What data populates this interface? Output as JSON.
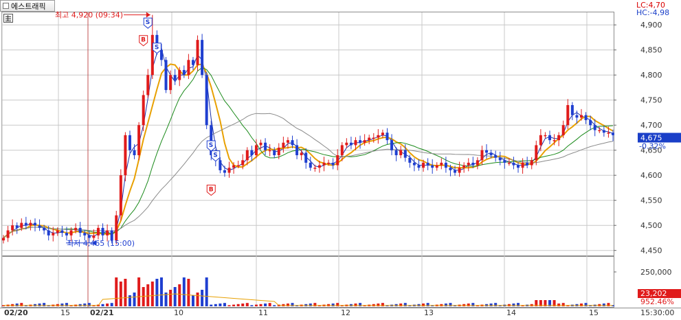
{
  "header": {
    "stock_tab_label": "에스트래픽",
    "lc_text": "LC:4,70",
    "hc_text": "HC:-4,98"
  },
  "annotations": {
    "high_text": "최고 4,920 (09:34)",
    "low_text": "최저 4,465 (15:00)",
    "current_price": "4,675",
    "change_pct": "-0.32%",
    "volume_current": "23,202",
    "volume_pct": "952.46%",
    "buy_marker": "B",
    "sell_marker": "S"
  },
  "price_axis": {
    "ticks": [
      "4,900",
      "4,850",
      "4,800",
      "4,750",
      "4,700",
      "4,650",
      "4,600",
      "4,550",
      "4,500",
      "4,450"
    ]
  },
  "volume_axis": {
    "ticks": [
      "250,000"
    ]
  },
  "time_axis": {
    "labels": [
      "02/20",
      "15",
      "02/21",
      "10",
      "11",
      "12",
      "13",
      "14",
      "15"
    ],
    "right_label": "15:30:00"
  },
  "colors": {
    "up": "#e01b1b",
    "down": "#1f3fd0",
    "ma_orange": "#e8a000",
    "ma_green": "#1a8a1a",
    "ma_gray": "#8a8a8a",
    "ma_blue": "#1a2fa8",
    "grid": "#c8c8c8",
    "marker_line": "#c05050"
  },
  "chart_data": {
    "type": "candlestick",
    "price_ylim": [
      4440,
      4925
    ],
    "high": {
      "value": 4920,
      "time": "09:34"
    },
    "low": {
      "value": 4465,
      "time": "15:00"
    },
    "current": 4675,
    "change_pct": -0.32,
    "volume_ylim": [
      0,
      350000
    ],
    "close_series": [
      4475,
      4490,
      4500,
      4495,
      4505,
      4500,
      4505,
      4500,
      4495,
      4490,
      4480,
      4485,
      4490,
      4485,
      4480,
      4490,
      4495,
      4485,
      4480,
      4475,
      4480,
      4495,
      4480,
      4490,
      4470,
      4520,
      4600,
      4680,
      4650,
      4640,
      4700,
      4760,
      4800,
      4880,
      4850,
      4830,
      4770,
      4800,
      4790,
      4810,
      4800,
      4830,
      4820,
      4870,
      4800,
      4700,
      4640,
      4630,
      4610,
      4605,
      4615,
      4620,
      4620,
      4630,
      4650,
      4640,
      4660,
      4665,
      4650,
      4650,
      4640,
      4655,
      4665,
      4670,
      4660,
      4640,
      4645,
      4625,
      4615,
      4615,
      4620,
      4625,
      4625,
      4620,
      4640,
      4660,
      4665,
      4660,
      4670,
      4665,
      4670,
      4675,
      4675,
      4680,
      4685,
      4670,
      4650,
      4640,
      4650,
      4635,
      4625,
      4620,
      4615,
      4625,
      4620,
      4615,
      4620,
      4625,
      4615,
      4610,
      4605,
      4615,
      4620,
      4625,
      4620,
      4630,
      4650,
      4645,
      4640,
      4635,
      4630,
      4625,
      4625,
      4620,
      4615,
      4625,
      4620,
      4630,
      4660,
      4680,
      4680,
      4670,
      4670,
      4680,
      4700,
      4740,
      4720,
      4715,
      4720,
      4710,
      4700,
      4690,
      4690,
      4685,
      4685,
      4680
    ]
  }
}
